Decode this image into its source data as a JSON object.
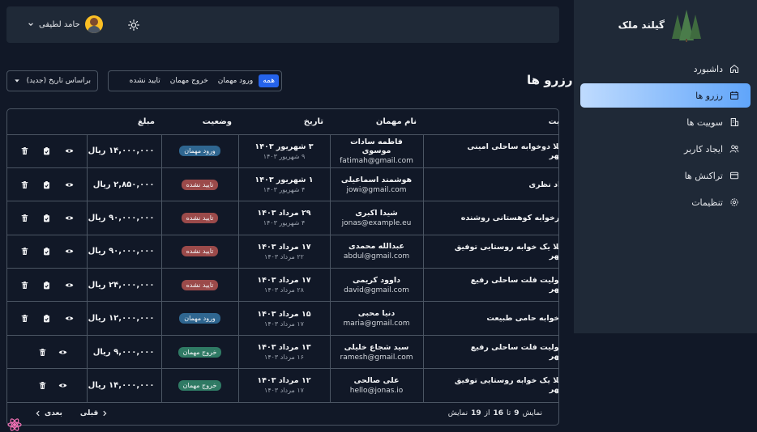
{
  "brand": {
    "name": "گیلند ملک"
  },
  "sidebar": {
    "items": [
      {
        "label": "داشبورد",
        "icon": "home-icon",
        "active": false
      },
      {
        "label": "رزرو ها",
        "icon": "calendar-icon",
        "active": true
      },
      {
        "label": "سوییت ها",
        "icon": "building-icon",
        "active": false
      },
      {
        "label": "ایجاد کاربر",
        "icon": "users-icon",
        "active": false
      },
      {
        "label": "تراکنش ها",
        "icon": "wallet-icon",
        "active": false
      },
      {
        "label": "تنظیمات",
        "icon": "gear-icon",
        "active": false
      }
    ]
  },
  "header": {
    "user_name": "حامد لطیفی"
  },
  "page": {
    "title": "رزرو ها",
    "filters": [
      "همه",
      "ورود مهمان",
      "خروج مهمان",
      "تایید نشده"
    ],
    "active_filter": "همه",
    "sort_label": "براساس تاریخ (جدید)"
  },
  "table": {
    "columns": [
      "نام سوییت",
      "نام مهمان",
      "تاریخ",
      "وضعیت",
      "مبلغ",
      ""
    ],
    "rows": [
      {
        "suite": "اجاره ویلا دوخوابه ساحلی امینی رضوانشهر",
        "guest": "فاطمه سادات موسوی",
        "email": "fatimah@gmail.com",
        "date": "۳ شهریور ۱۴۰۳",
        "year": "۹ شهریور ۱۴۰۳",
        "status": "ورود مهمان",
        "amount": "۱۴,۰۰۰,۰۰۰ ریال",
        "actions": 3
      },
      {
        "suite": "ویلا بهزاد نظری",
        "guest": "هوشمند اسماعیلی",
        "email": "jowi@gmail.com",
        "date": "۱ شهریور ۱۴۰۳",
        "year": "۴ شهریور ۱۴۰۳",
        "status": "تایید نشده",
        "amount": "۲,۸۵۰,۰۰۰ ریال",
        "actions": 3
      },
      {
        "suite": "ویلا چهارخوابه کوهستانی روشنده",
        "guest": "شیدا اکبری",
        "email": "jonas@example.eu",
        "date": "۲۹ مرداد ۱۴۰۳",
        "year": "۴ شهریور ۱۴۰۳",
        "status": "تایید نشده",
        "amount": "۹۰,۰۰۰,۰۰۰ ریال",
        "actions": 3
      },
      {
        "suite": "اجاره ویلا یک خوابه روستایی توفیق رضوانشهر",
        "guest": "عبدالله محمدی",
        "email": "abdul@gmail.com",
        "date": "۱۷ مرداد ۱۴۰۳",
        "year": "۲۲ مرداد ۱۴۰۳",
        "status": "تایید نشده",
        "amount": "۹۰,۰۰۰,۰۰۰ ریال",
        "actions": 3
      },
      {
        "suite": "اجاره سولیت فلت ساحلی رفیع رضوانشهر",
        "guest": "داوود کریمی",
        "email": "david@gmail.com",
        "date": "۱۷ مرداد ۱۴۰۳",
        "year": "۲۸ مرداد ۱۴۰۳",
        "status": "تایید نشده",
        "amount": "۲۴,۰۰۰,۰۰۰ ریال",
        "actions": 3
      },
      {
        "suite": "ویلا یک خوابه حامی طبیعت",
        "guest": "دنیا محبی",
        "email": "maria@gmail.com",
        "date": "۱۵ مرداد ۱۴۰۳",
        "year": "۱۷ مرداد ۱۴۰۳",
        "status": "ورود مهمان",
        "amount": "۱۲,۰۰۰,۰۰۰ ریال",
        "actions": 3
      },
      {
        "suite": "اجاره سولیت فلت ساحلی رفیع رضوانشهر",
        "guest": "سید شجاع خلیلی",
        "email": "ramesh@gmail.com",
        "date": "۱۳ مرداد ۱۴۰۳",
        "year": "۱۶ مرداد ۱۴۰۳",
        "status": "خروج مهمان",
        "amount": "۹,۰۰۰,۰۰۰ ریال",
        "actions": 2
      },
      {
        "suite": "اجاره ویلا یک خوابه روستایی توفیق رضوانشهر",
        "guest": "علی صالحی",
        "email": "hello@jonas.io",
        "date": "۱۲ مرداد ۱۴۰۳",
        "year": "۱۷ مرداد ۱۴۰۳",
        "status": "خروج مهمان",
        "amount": "۱۴,۰۰۰,۰۰۰ ریال",
        "actions": 2
      }
    ]
  },
  "status_colors": {
    "ورود مهمان": "#2f6690",
    "تایید نشده": "#9b4a4a",
    "خروج مهمان": "#2f7a64"
  },
  "pagination": {
    "word_show": "نمایش",
    "from": "9",
    "word_to": "تا",
    "to": "16",
    "word_of": "از",
    "total": "19",
    "word_show2": "نمایش",
    "prev_label": "قبلی",
    "next_label": "بعدی"
  }
}
